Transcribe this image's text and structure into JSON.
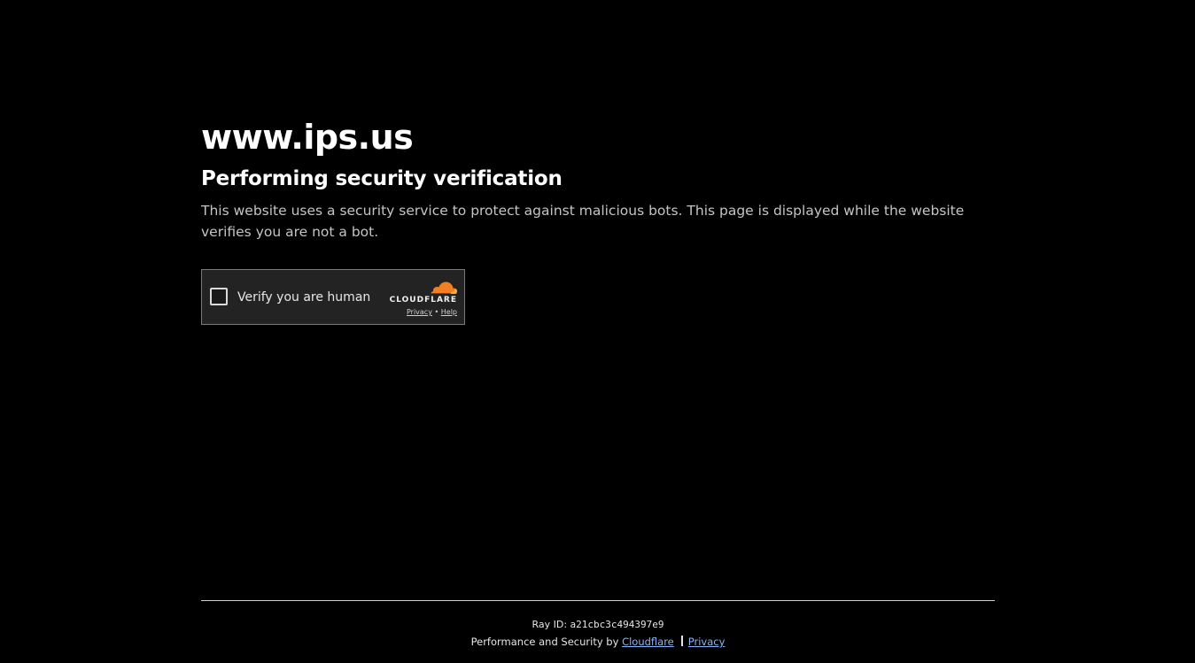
{
  "site": {
    "title": "www.ips.us"
  },
  "content": {
    "heading": "Performing security verification",
    "description": "This website uses a security service to protect against malicious bots. This page is displayed while the website verifies you are not a bot."
  },
  "widget": {
    "checkbox_label": "Verify you are human",
    "checked": false,
    "brand_wordmark": "CLOUDFLARE",
    "privacy_link": "Privacy",
    "link_separator": "•",
    "help_link": "Help",
    "logo_icon": "cloudflare-cloud-icon",
    "logo_color": "#f38020"
  },
  "footer": {
    "ray_label": "Ray ID:",
    "ray_id": "a21cbc3c494397e9",
    "performance_text": "Performance and Security by",
    "cloudflare_link": "Cloudflare",
    "privacy_link": "Privacy"
  }
}
